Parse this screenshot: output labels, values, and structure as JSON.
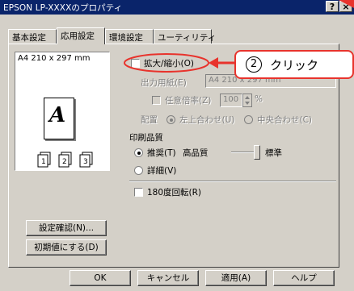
{
  "window": {
    "title": "EPSON LP-XXXXのプロパティ",
    "help_label": "?",
    "close_label": "×"
  },
  "tabs": [
    {
      "label": "基本設定"
    },
    {
      "label": "応用設定"
    },
    {
      "label": "環境設定"
    },
    {
      "label": "ユーティリティ"
    }
  ],
  "preview": {
    "paper_size": "A4 210 x 297 mm",
    "letter": "A",
    "mini_pages": [
      "1",
      "2",
      "3"
    ]
  },
  "options": {
    "scale_label": "拡大/縮小(O)",
    "output_paper_label": "出力用紙(E)",
    "output_paper_value": "A4 210 x 297 mm",
    "ratio_label": "任意倍率(Z)",
    "ratio_value": "100",
    "ratio_unit": "%",
    "placement_label": "配置",
    "placement_left_top": "左上合わせ(U)",
    "placement_center": "中央合わせ(C)",
    "print_quality_label": "印刷品質",
    "recommended_label": "推奨(T)",
    "quality_high": "高品質",
    "quality_standard": "標準",
    "quality_slider_level": 1.0,
    "detail_label": "詳細(V)",
    "rotate_label": "180度回転(R)"
  },
  "buttons": {
    "confirm_settings": "設定確認(N)...",
    "restore_defaults": "初期値にする(D)",
    "ok": "OK",
    "cancel": "キャンセル",
    "apply": "適用(A)",
    "help": "ヘルプ"
  },
  "callout": {
    "number": "2",
    "text": "クリック",
    "color": "#e8332c"
  }
}
